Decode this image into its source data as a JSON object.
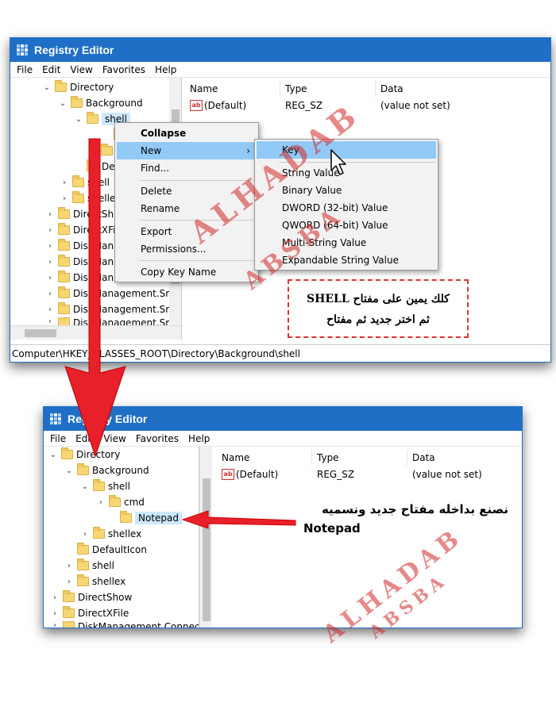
{
  "app": {
    "title": "Registry Editor"
  },
  "menubar": [
    "File",
    "Edit",
    "View",
    "Favorites",
    "Help"
  ],
  "window1": {
    "tree": [
      {
        "label": "Directory",
        "chev": "⌄"
      },
      {
        "label": "Background",
        "chev": "⌄"
      },
      {
        "label": "shell",
        "chev": "⌄"
      },
      {
        "label": "",
        "chev": ""
      },
      {
        "label": "sh",
        "chev": "›"
      },
      {
        "label": "Defa",
        "chev": ""
      },
      {
        "label": "shell",
        "chev": "›"
      },
      {
        "label": "shelle",
        "chev": "›"
      },
      {
        "label": "DirectSh",
        "chev": "›"
      },
      {
        "label": "DirectXFi",
        "chev": "›"
      },
      {
        "label": "DiskMan",
        "chev": "›"
      },
      {
        "label": "DiskMan",
        "chev": "›"
      },
      {
        "label": "DiskMan",
        "chev": "›"
      },
      {
        "label": "DiskManagement.Sr",
        "chev": "›"
      },
      {
        "label": "DiskManagement.Sr",
        "chev": "›"
      },
      {
        "label": "DiskManagement.Sr",
        "chev": "›"
      }
    ],
    "status_path": "Computer\\HKEY_CLASSES_ROOT\\Directory\\Background\\shell"
  },
  "columns": {
    "name": "Name",
    "type": "Type",
    "data": "Data"
  },
  "value_row": {
    "name": "(Default)",
    "type": "REG_SZ",
    "data": "(value not set)",
    "icon_text": "ab"
  },
  "context_menu": {
    "collapse": "Collapse",
    "new": "New",
    "find": "Find...",
    "delete": "Delete",
    "rename": "Rename",
    "export": "Export",
    "permissions": "Permissions...",
    "copy_key_name": "Copy Key Name",
    "submenu_arrow": "›"
  },
  "submenu": {
    "key": "Key",
    "string_value": "String Value",
    "binary_value": "Binary Value",
    "dword_value": "DWORD (32-bit) Value",
    "qword_value": "QWORD (64-bit) Value",
    "multi_string_value": "Multi-String Value",
    "expandable_string_value": "Expandable String Value"
  },
  "note1": {
    "line1": "كلك يمين على مفتاح SHELL",
    "line2": "ثم اختر جديد ثم مفتاح"
  },
  "window2": {
    "tree": [
      {
        "label": "Directory",
        "chev": "⌄"
      },
      {
        "label": "Background",
        "chev": "⌄"
      },
      {
        "label": "shell",
        "chev": "⌄"
      },
      {
        "label": "cmd",
        "chev": "›"
      },
      {
        "label": "Notepad",
        "chev": ""
      },
      {
        "label": "shellex",
        "chev": "›"
      },
      {
        "label": "DefaultIcon",
        "chev": ""
      },
      {
        "label": "shell",
        "chev": "›"
      },
      {
        "label": "shellex",
        "chev": "›"
      },
      {
        "label": "DirectShow",
        "chev": "›"
      },
      {
        "label": "DirectXFile",
        "chev": "›"
      },
      {
        "label": "DiskManagement.Connec",
        "chev": "›"
      }
    ]
  },
  "note2": {
    "line1": "نصنع بداخله مفتاح جديد ونسميه",
    "line2": "Notepad"
  },
  "watermark": {
    "line1": "ALHADAB",
    "line2": "ABSBA"
  },
  "colors": {
    "titlebar": "#1f6fc6",
    "menu_highlight": "#91c9f7",
    "selection": "#cce8ff",
    "arrow": "#e8202a",
    "watermark": "#d22828"
  }
}
